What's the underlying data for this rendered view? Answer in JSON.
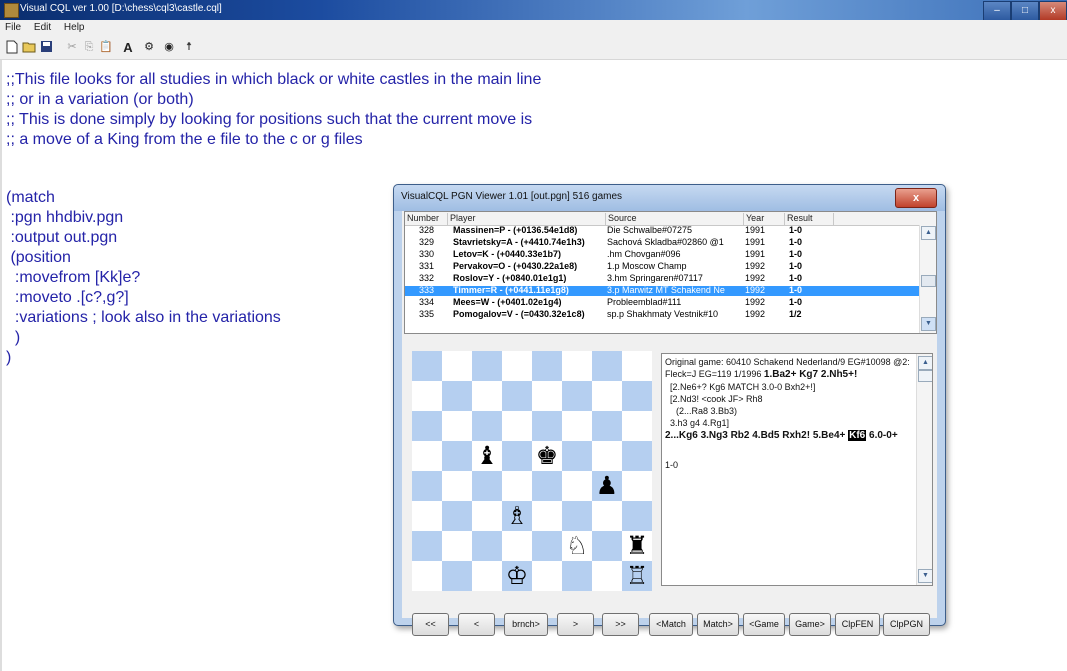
{
  "window": {
    "title": "Visual CQL ver 1.00 [D:\\chess\\cql3\\castle.cql]",
    "minimize": "–",
    "maximize": "□",
    "close": "x"
  },
  "menu": [
    "File",
    "Edit",
    "Help"
  ],
  "toolbar": {
    "icons": [
      "new-file-icon",
      "open-folder-icon",
      "save-icon",
      "cut-icon",
      "copy-icon",
      "paste-icon",
      "font-icon",
      "run-icon",
      "view-icon",
      "figure-icon"
    ],
    "font_label": "A"
  },
  "editor": {
    "lines": [
      ";;This file looks for all studies in which black or white castles in the main line",
      ";; or in a variation (or both)",
      ";; This is done simply by looking for positions such that the current move is",
      ";; a move of a King from the e file to the c or g files",
      "(match",
      " :pgn hhdbiv.pgn",
      " :output out.pgn",
      " (position",
      "  :movefrom [Kk]e?",
      "  :moveto .[c?,g?]",
      "  :variations ; look also in the variations",
      "  )",
      ")"
    ]
  },
  "viewer": {
    "title": "VisualCQL PGN Viewer 1.01   [out.pgn]   516 games",
    "close": "x",
    "columns": [
      "Number",
      "Player",
      "Source",
      "Year",
      "Result"
    ],
    "games": [
      {
        "num": "328",
        "player": "Massinen=P - (+0136.54e1d8)",
        "source": "Die Schwalbe#07275",
        "year": "1991",
        "result": "1-0"
      },
      {
        "num": "329",
        "player": "Stavrietsky=A - (+4410.74e1h3)",
        "source": "Sachová Skladba#02860 @1",
        "year": "1991",
        "result": "1-0"
      },
      {
        "num": "330",
        "player": "Letov=K - (+0440.33e1b7)",
        "source": ".hm Chovgan#096",
        "year": "1991",
        "result": "1-0"
      },
      {
        "num": "331",
        "player": "Pervakov=O - (+0430.22a1e8)",
        "source": "1.p Moscow Champ",
        "year": "1992",
        "result": "1-0"
      },
      {
        "num": "332",
        "player": "Roslov=Y - (+0840.01e1g1)",
        "source": "3.hm Springaren#07117",
        "year": "1992",
        "result": "1-0"
      },
      {
        "num": "333",
        "player": "Timmer=R - (+0441.11e1g8)",
        "source": "3.p Marwitz MT Schakend Ne",
        "year": "1992",
        "result": "1-0"
      },
      {
        "num": "334",
        "player": "Mees=W - (+0401.02e1g4)",
        "source": "Probleemblad#111",
        "year": "1992",
        "result": "1-0"
      },
      {
        "num": "335",
        "player": "Pomogalov=V - (=0430.32e1c8)",
        "source": "sp.p Shakhmaty Vestnik#10",
        "year": "1992",
        "result": "1/2"
      }
    ],
    "selected_game": "333",
    "pieces": [
      {
        "glyph": "♝",
        "square": "c5",
        "name": "black-bishop-c5"
      },
      {
        "glyph": "♚",
        "square": "e5",
        "name": "black-king-e5"
      },
      {
        "glyph": "♟",
        "square": "g4",
        "name": "black-pawn-g4"
      },
      {
        "glyph": "♗",
        "square": "d3",
        "name": "white-bishop-d3"
      },
      {
        "glyph": "♘",
        "square": "f2",
        "name": "white-knight-f2"
      },
      {
        "glyph": "♜",
        "square": "h2",
        "name": "black-rook-h2"
      },
      {
        "glyph": "♔",
        "square": "d1",
        "name": "white-king-d1"
      },
      {
        "glyph": "♖",
        "square": "h1",
        "name": "white-rook-h1"
      }
    ],
    "notation": {
      "line1": "Original game: 60410 Schakend Nederland/9 EG#10098 @2:",
      "line2_a": "Fleck=J EG=119 1/1996 ",
      "line2_b": "1.Ba2+ Kg7 2.Nh5+!",
      "line3": "[2.Ne6+? Kg6 MATCH 3.0-0 Bxh2+!]",
      "line4": "[2.Nd3! <cook JF> Rh8",
      "line5": "(2...Ra8 3.Bb3)",
      "line6": "3.h3 g4 4.Rg1]",
      "line7_a": "2...Kg6 3.Ng3 Rb2 4.Bd5 Rxh2! 5.Be4+ ",
      "line7_hl": "Kf6",
      "line7_b": " 6.0-0+",
      "result": "1-0"
    },
    "buttons": [
      "<<",
      "<",
      "brnch>",
      ">",
      ">>",
      "<Match",
      "Match>",
      "<Game",
      "Game>",
      "ClpFEN",
      "ClpPGN"
    ]
  }
}
